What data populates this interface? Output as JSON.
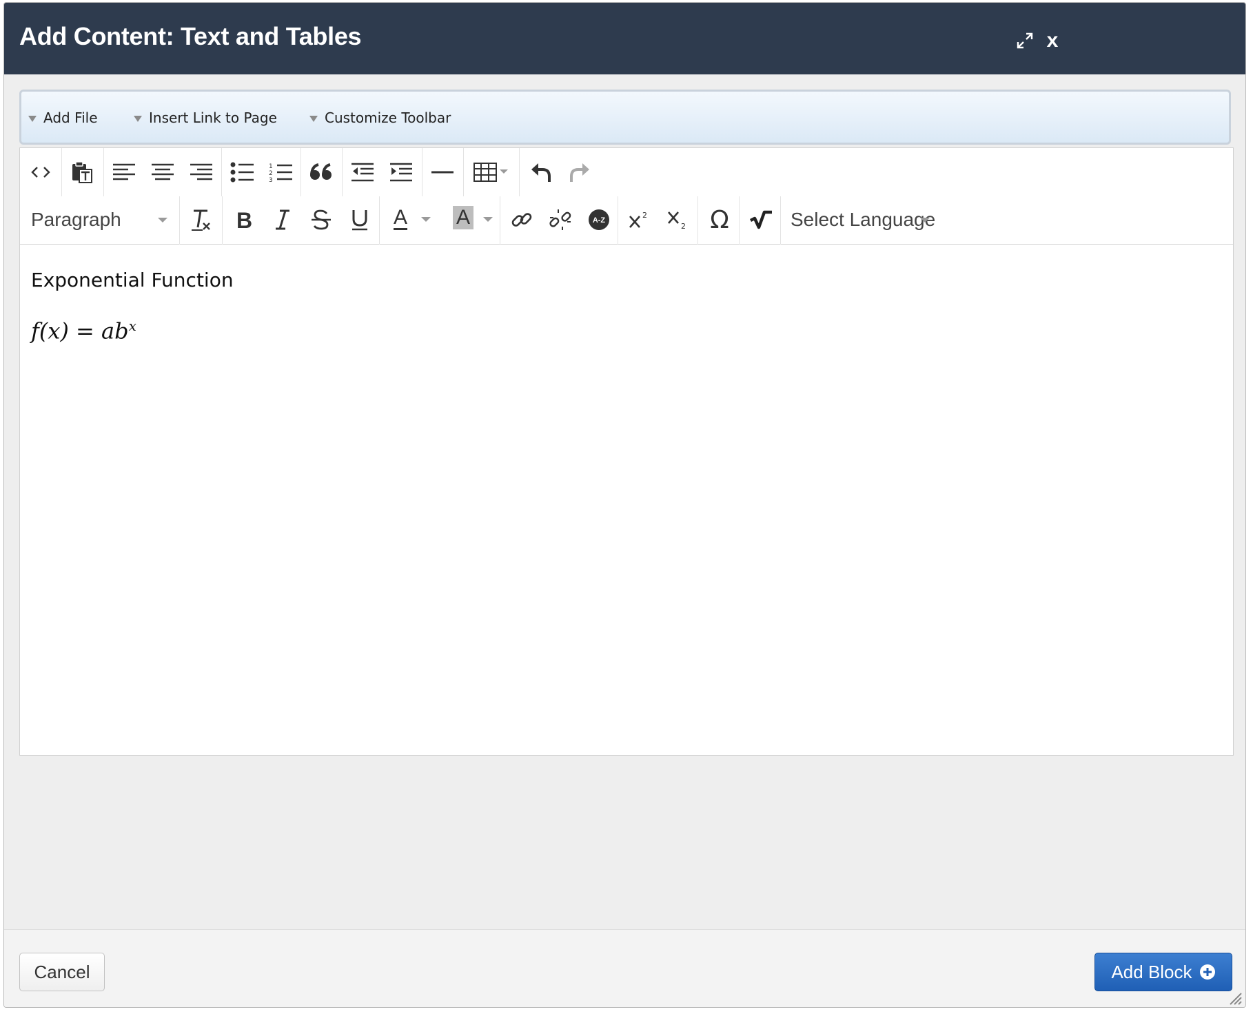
{
  "dialog": {
    "title": "Add Content: Text and Tables",
    "expand_icon": "expand-arrows-icon",
    "close_label": "x"
  },
  "panel": {
    "links": [
      {
        "label": "Add File"
      },
      {
        "label": "Insert Link to Page"
      },
      {
        "label": "Customize Toolbar"
      }
    ]
  },
  "toolbar": {
    "format_select": {
      "value": "Paragraph"
    },
    "language_select": {
      "value": "Select Language"
    },
    "text_color_glyph": "A",
    "bg_color_glyph": "A",
    "omega_glyph": "Ω"
  },
  "content": {
    "heading": "Exponential Function",
    "formula": {
      "main": "f(x) = ab",
      "exponent": "x"
    }
  },
  "footer": {
    "cancel_label": "Cancel",
    "add_block_label": "Add Block"
  },
  "colors": {
    "titlebar": "#2e3b4e",
    "primary_button": "#2a6cc4"
  }
}
